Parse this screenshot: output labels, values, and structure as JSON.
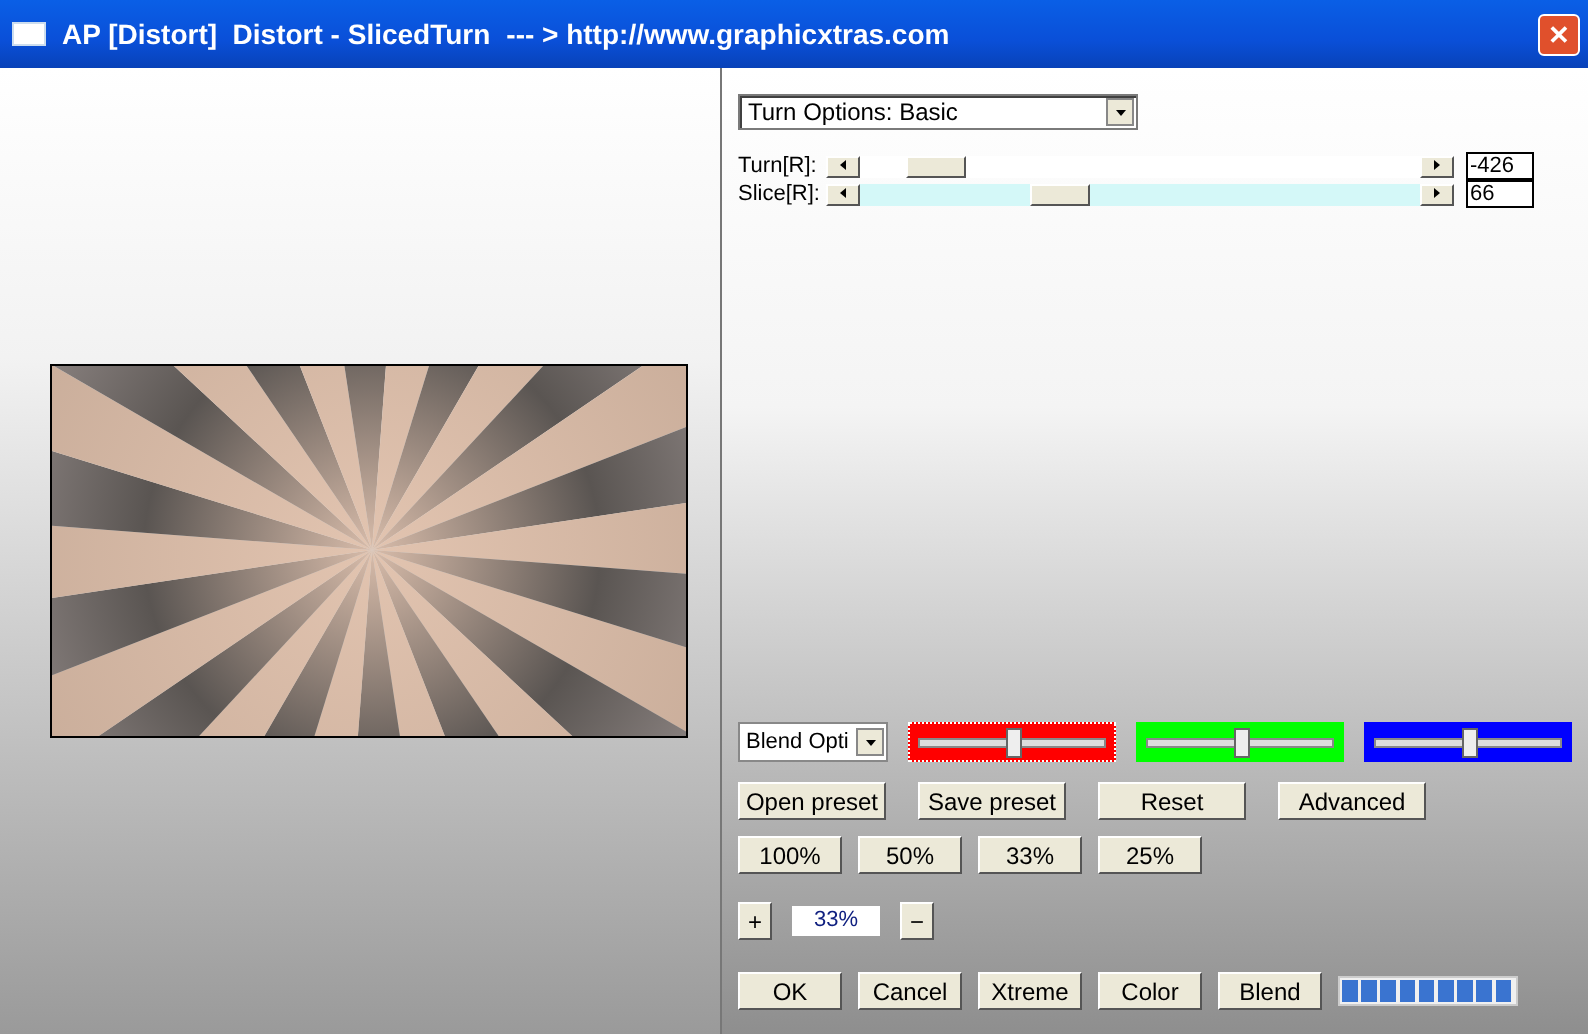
{
  "window": {
    "title": "AP [Distort]  Distort - SlicedTurn",
    "url": "--- > http://www.graphicxtras.com",
    "close": "✕"
  },
  "options_dropdown": {
    "value": "Turn Options: Basic"
  },
  "sliders": [
    {
      "label": "Turn[R]:",
      "level": 0.09,
      "value": "-426",
      "tinted": false
    },
    {
      "label": "Slice[R]:",
      "level": 0.34,
      "value": "66",
      "tinted": true
    }
  ],
  "blend": {
    "dropdown": "Blend Opti",
    "channels": [
      {
        "color": "#ff0000",
        "level": 0.5,
        "focused": true
      },
      {
        "color": "#00ff00",
        "level": 0.5,
        "focused": false
      },
      {
        "color": "#0000ff",
        "level": 0.5,
        "focused": false
      }
    ]
  },
  "preset_buttons": [
    "Open preset",
    "Save preset",
    "Reset",
    "Advanced"
  ],
  "zoom_buttons": [
    "100%",
    "50%",
    "33%",
    "25%"
  ],
  "zoom_stepper": {
    "plus": "+",
    "value": "33%",
    "minus": "−"
  },
  "action_buttons": [
    "OK",
    "Cancel",
    "Xtreme",
    "Color",
    "Blend"
  ],
  "progress": {
    "level": 1
  }
}
